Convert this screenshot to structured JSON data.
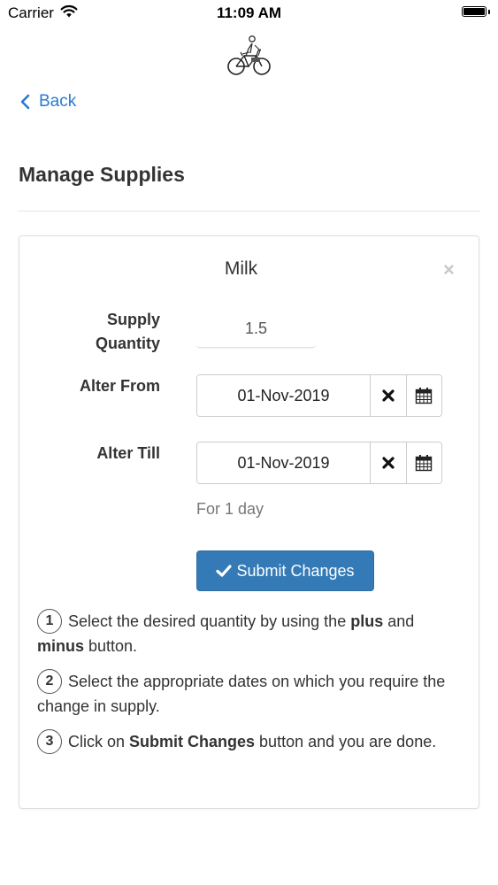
{
  "status_bar": {
    "carrier": "Carrier",
    "time": "11:09 AM"
  },
  "nav": {
    "back_label": "Back"
  },
  "page": {
    "title": "Manage Supplies"
  },
  "card": {
    "item_name": "Milk",
    "close_symbol": "×",
    "quantity_label": "Supply Quantity",
    "quantity_value": "1.5",
    "alter_from_label": "Alter From",
    "alter_from_value": "01-Nov-2019",
    "alter_till_label": "Alter Till",
    "alter_till_value": "01-Nov-2019",
    "duration_text": "For 1 day",
    "submit_label": "Submit Changes",
    "steps": [
      {
        "number": "1",
        "text_a": "Select the desired quantity by using the ",
        "bold_a": "plus",
        "text_b": " and ",
        "bold_b": "minus",
        "text_c": " button."
      },
      {
        "number": "2",
        "text": "Select the appropriate dates on which you require the change in supply."
      },
      {
        "number": "3",
        "text_a": "Click on ",
        "bold": "Submit Changes",
        "text_b": " button and you are done."
      }
    ]
  },
  "icons": {
    "wifi": "wifi-icon",
    "battery": "battery-icon",
    "logo": "bicycle-logo",
    "back": "chevron-left-icon",
    "close": "close-icon",
    "clear": "times-icon",
    "calendar": "calendar-icon",
    "check": "check-icon"
  },
  "colors": {
    "accent": "#337ab7",
    "link": "#2a7ad3",
    "text": "#333333",
    "muted": "#777777"
  }
}
